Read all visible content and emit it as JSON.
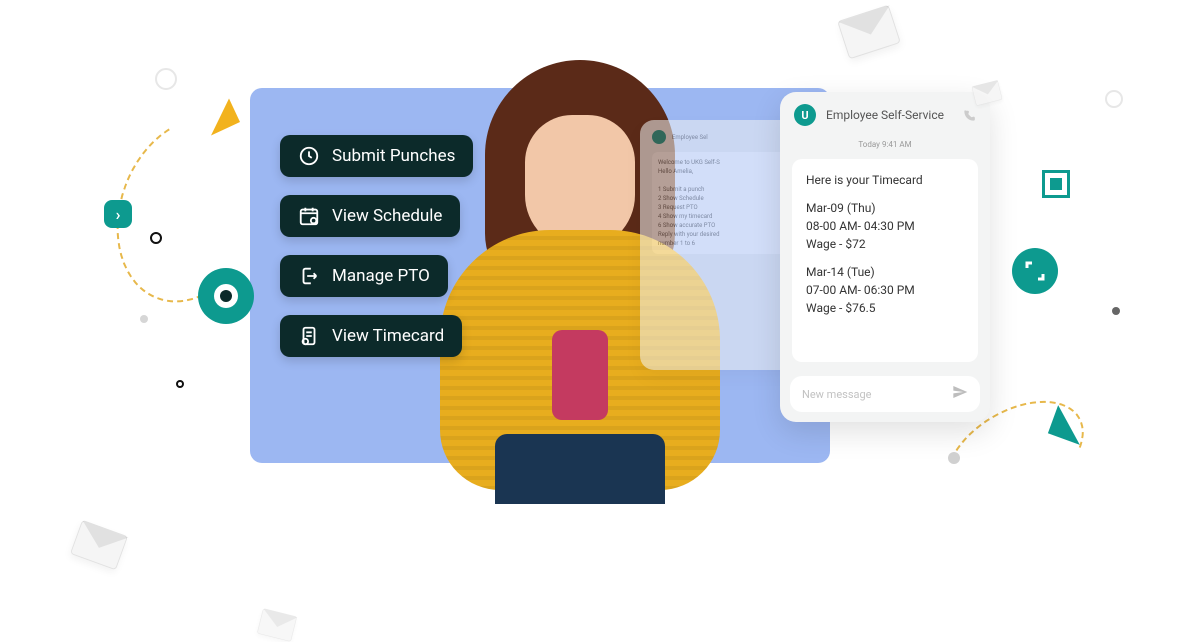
{
  "actions": {
    "submit_punches": "Submit Punches",
    "view_schedule": "View Schedule",
    "manage_pto": "Manage PTO",
    "view_timecard": "View Timecard"
  },
  "chat_back": {
    "title": "Employee Sel",
    "message": "Welcome to UKG Self-S\nHello Amelia,\n\n1 Submit a punch\n2 Show Schedule\n3 Request PTO\n4 Show my timecard\n6 Show accurate PTO\nReply with your desired\nnumber 1 to 6"
  },
  "chat_front": {
    "title": "Employee Self-Service",
    "timeline": "Today 9:41 AM",
    "bubble": {
      "heading": "Here is your Timecard",
      "entries": [
        {
          "date": "Mar-09 (Thu)",
          "hours": "08-00 AM- 04:30 PM",
          "wage": "Wage - $72"
        },
        {
          "date": "Mar-14 (Tue)",
          "hours": "07-00 AM- 06:30 PM",
          "wage": "Wage - $76.5"
        }
      ]
    },
    "input_placeholder": "New message"
  }
}
